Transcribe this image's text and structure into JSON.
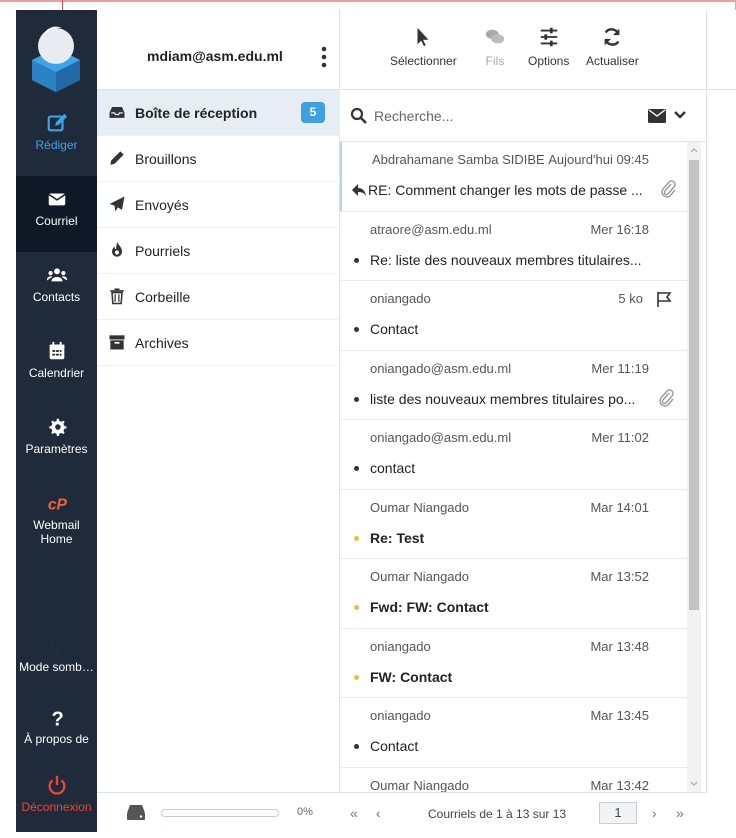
{
  "nav": {
    "items": [
      {
        "label": "Rédiger",
        "icon": "compose-icon"
      },
      {
        "label": "Courriel",
        "icon": "envelope-icon"
      },
      {
        "label": "Contacts",
        "icon": "users-icon"
      },
      {
        "label": "Calendrier",
        "icon": "calendar-icon"
      },
      {
        "label": "Paramètres",
        "icon": "gear-icon"
      },
      {
        "label": "Webmail Home",
        "icon": "cpanel-icon"
      },
      {
        "label": "Mode somb…",
        "icon": "moon-icon"
      },
      {
        "label": "À propos de",
        "icon": "question-icon"
      },
      {
        "label": "Déconnexion",
        "icon": "power-icon"
      }
    ]
  },
  "account": {
    "email": "mdiam@asm.edu.ml"
  },
  "folders": [
    {
      "name": "Boîte de réception",
      "icon": "inbox-icon",
      "unread": "5"
    },
    {
      "name": "Brouillons",
      "icon": "pencil-icon"
    },
    {
      "name": "Envoyés",
      "icon": "paper-plane-icon"
    },
    {
      "name": "Pourriels",
      "icon": "fire-icon"
    },
    {
      "name": "Corbeille",
      "icon": "trash-icon"
    },
    {
      "name": "Archives",
      "icon": "archive-icon"
    }
  ],
  "quota": {
    "percent": "0%",
    "usage_fraction": 0
  },
  "toolbar": {
    "select": "Sélectionner",
    "threads": "Fils",
    "options": "Options",
    "refresh": "Actualiser"
  },
  "search": {
    "placeholder": "Recherche..."
  },
  "messages": [
    {
      "from": "Abdrahamane Samba SIDIBE",
      "date": "Aujourd'hui 09:45",
      "subject": "RE: Comment changer les mots de passe ...",
      "unread": false,
      "replied": true,
      "attachment": true
    },
    {
      "from": "atraore@asm.edu.ml",
      "date": "Mer 16:18",
      "subject": "Re: liste des nouveaux membres titulaires...",
      "unread": false
    },
    {
      "from": "oniangado",
      "date": "5 ko",
      "subject": "Contact",
      "unread": false,
      "flag": true
    },
    {
      "from": "oniangado@asm.edu.ml",
      "date": "Mer 11:19",
      "subject": "liste des nouveaux membres titulaires po...",
      "unread": false,
      "attachment": true
    },
    {
      "from": "oniangado@asm.edu.ml",
      "date": "Mer 11:02",
      "subject": "contact",
      "unread": false
    },
    {
      "from": "Oumar Niangado",
      "date": "Mar 14:01",
      "subject": "Re: Test",
      "unread": true
    },
    {
      "from": "Oumar Niangado",
      "date": "Mar 13:52",
      "subject": "Fwd: FW: Contact",
      "unread": true
    },
    {
      "from": "oniangado",
      "date": "Mar 13:48",
      "subject": "FW: Contact",
      "unread": true
    },
    {
      "from": "oniangado",
      "date": "Mar 13:45",
      "subject": "Contact",
      "unread": false
    },
    {
      "from": "Oumar Niangado",
      "date": "Mar 13:42",
      "subject": "",
      "unread": false
    }
  ],
  "pager": {
    "info": "Courriels de 1 à 13 sur 13",
    "page": "1"
  },
  "colors": {
    "nav_bg": "#1f2a3a",
    "accent": "#3f9fe0",
    "unread_dot": "#f5b942",
    "logout": "#e8463c"
  }
}
